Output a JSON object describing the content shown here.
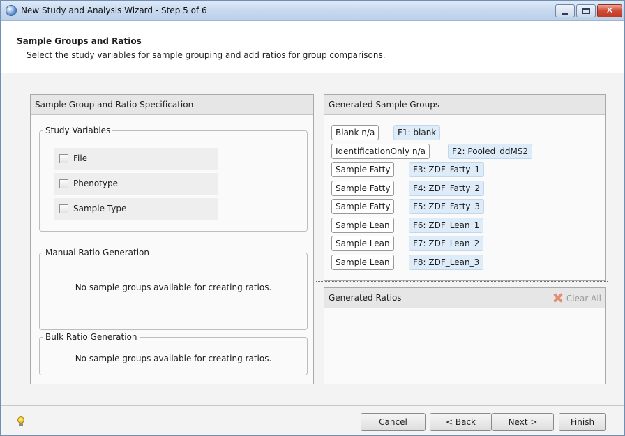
{
  "window": {
    "title": "New Study and Analysis Wizard - Step 5 of 6"
  },
  "header": {
    "title": "Sample Groups and Ratios",
    "subtitle": "Select the study variables for sample grouping and add ratios for group comparisons."
  },
  "left_panel": {
    "title": "Sample Group and Ratio Specification",
    "study_variables": {
      "title": "Study Variables",
      "items": [
        {
          "label": "File",
          "checked": false
        },
        {
          "label": "Phenotype",
          "checked": false
        },
        {
          "label": "Sample Type",
          "checked": false
        }
      ]
    },
    "manual_ratio": {
      "title": "Manual Ratio Generation",
      "message": "No sample groups available for creating ratios."
    },
    "bulk_ratio": {
      "title": "Bulk Ratio Generation",
      "message": "No sample groups available for creating ratios."
    }
  },
  "generated_groups": {
    "title": "Generated Sample Groups",
    "rows": [
      {
        "group": "Blank  n/a",
        "file": "F1: blank"
      },
      {
        "group": "IdentificationOnly  n/a",
        "file": "F2: Pooled_ddMS2"
      },
      {
        "group": "Sample  Fatty",
        "file": "F3: ZDF_Fatty_1"
      },
      {
        "group": "Sample  Fatty",
        "file": "F4: ZDF_Fatty_2"
      },
      {
        "group": "Sample  Fatty",
        "file": "F5: ZDF_Fatty_3"
      },
      {
        "group": "Sample  Lean",
        "file": "F6: ZDF_Lean_1"
      },
      {
        "group": "Sample  Lean",
        "file": "F7: ZDF_Lean_2"
      },
      {
        "group": "Sample  Lean",
        "file": "F8: ZDF_Lean_3"
      }
    ]
  },
  "generated_ratios": {
    "title": "Generated Ratios",
    "clear_all_label": "Clear All"
  },
  "footer": {
    "cancel": "Cancel",
    "back": "< Back",
    "next": "Next >",
    "finish": "Finish"
  }
}
